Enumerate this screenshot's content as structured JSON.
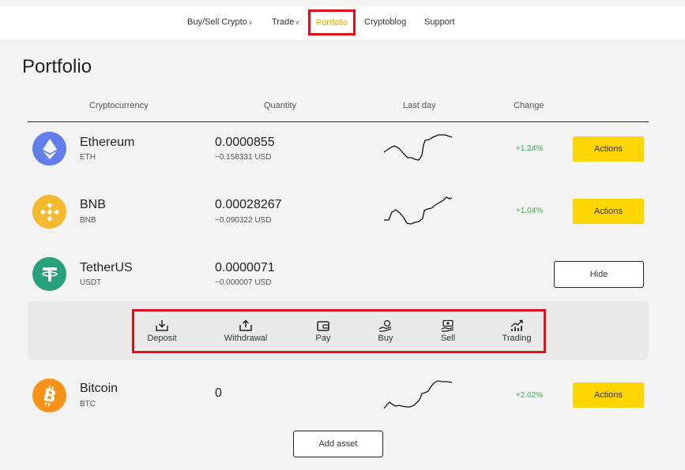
{
  "nav": {
    "buy_sell": "Buy/Sell Crypto",
    "trade": "Trade",
    "portfolio": "Portfolio",
    "cryptoblog": "Cryptoblog",
    "support": "Support",
    "chevron": "v"
  },
  "page_title": "Portfolio",
  "table_headers": {
    "crypto": "Cryptocurrency",
    "quantity": "Quantity",
    "last_day": "Last day",
    "change": "Change"
  },
  "assets": [
    {
      "name": "Ethereum",
      "symbol": "ETH",
      "quantity": "0.0000855",
      "usd": "~0.158331 USD",
      "change": "+1.24%",
      "action": "Actions",
      "icon": "ethereum-icon",
      "color": "#627eea"
    },
    {
      "name": "BNB",
      "symbol": "BNB",
      "quantity": "0.00028267",
      "usd": "~0.090322 USD",
      "change": "+1.04%",
      "action": "Actions",
      "icon": "bnb-icon",
      "color": "#f3ba2f"
    },
    {
      "name": "TetherUS",
      "symbol": "USDT",
      "quantity": "0.0000071",
      "usd": "~0.000007 USD",
      "action": "Hide",
      "icon": "tether-icon",
      "color": "#26a17b"
    },
    {
      "name": "Bitcoin",
      "symbol": "BTC",
      "quantity": "0",
      "change": "+2.02%",
      "action": "Actions",
      "icon": "bitcoin-icon",
      "color": "#f7931a"
    }
  ],
  "actions": {
    "deposit": "Deposit",
    "withdrawal": "Withdrawal",
    "pay": "Pay",
    "buy": "Buy",
    "sell": "Sell",
    "trading": "Trading"
  },
  "add_asset": "Add asset",
  "colors": {
    "accent_yellow": "#ffd600",
    "active_nav": "#f2a900",
    "positive": "#3ab54a",
    "highlight_red": "#e0101a"
  }
}
